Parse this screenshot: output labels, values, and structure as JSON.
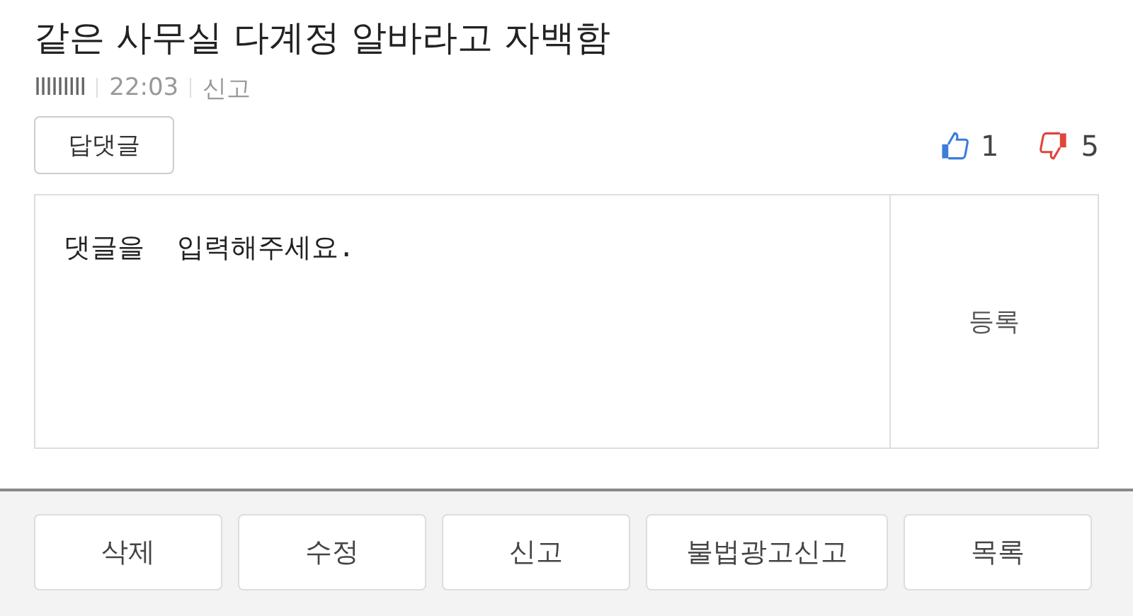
{
  "post": {
    "title": "같은 사무실 다계정 알바라고 자백함",
    "author": "IIIIIIIII",
    "time": "22:03",
    "report": "신고"
  },
  "reply_button": "답댓글",
  "votes": {
    "up": "1",
    "down": "5"
  },
  "comment": {
    "placeholder": "댓글을  입력해주세요.",
    "submit": "등록"
  },
  "buttons": [
    "삭제",
    "수정",
    "신고",
    "불법광고신고",
    "목록"
  ]
}
